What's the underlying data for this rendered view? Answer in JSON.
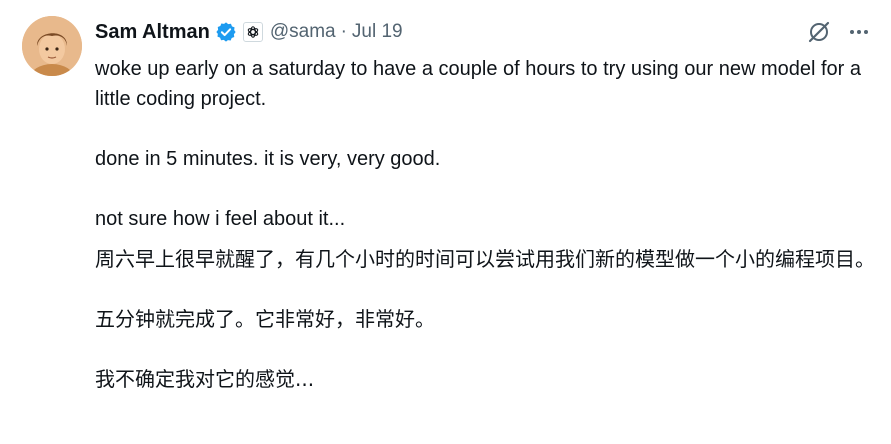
{
  "tweet": {
    "author": {
      "display_name": "Sam Altman",
      "handle": "@sama",
      "separator": "·",
      "date": "Jul 19",
      "verified_color": "#1d9bf0",
      "avatar_icon": "avatar-illustration",
      "affiliate_icon": "openai-logo-icon"
    },
    "actions": {
      "grok_icon": "grok-icon",
      "more_icon": "more-icon"
    },
    "english": [
      "woke up early on a saturday to have a couple of hours to try using our new model for a little coding project.",
      "done in 5 minutes. it is very, very good.",
      "not sure how i feel about it..."
    ],
    "translation": [
      "周六早上很早就醒了，有几个小时的时间可以尝试用我们新的模型做一个小的编程项目。",
      "五分钟就完成了。它非常好，非常好。",
      "我不确定我对它的感觉..."
    ]
  }
}
